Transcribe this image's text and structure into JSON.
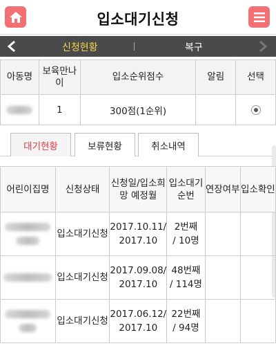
{
  "header": {
    "title": "입소대기신청",
    "home_icon": "home-icon",
    "menu_icon": "hamburger-menu-icon",
    "accent_color": "#f26f73"
  },
  "subnav": {
    "active_tab": "신청현황",
    "other_tab": "복구",
    "active_color": "#f4d44e"
  },
  "summary_table": {
    "headers": [
      "아동명",
      "보육만나이",
      "입소순위점수",
      "알림",
      "선택"
    ],
    "row": {
      "age": "1",
      "score": "300점(1순위)",
      "notice": "",
      "selected": true
    }
  },
  "tabs": {
    "waiting": "대기현황",
    "hold": "보류현황",
    "cancel": "취소내역"
  },
  "waiting_table": {
    "headers": [
      "어린이집명",
      "신청상태",
      "신청일/입소희망 예정월",
      "입소대기 순번",
      "연장여부",
      "입소확인"
    ],
    "rows": [
      {
        "status": "입소대기신청",
        "date1": "2017.10.11/",
        "date2": "2017.10",
        "rank1": "2번째",
        "rank2": "/ 10명",
        "extension": "",
        "confirm": ""
      },
      {
        "status": "입소대기신청",
        "date1": "2017.09.08/",
        "date2": "2017.10",
        "rank1": "48번째",
        "rank2": "/ 114명",
        "extension": "",
        "confirm": ""
      },
      {
        "status": "입소대기신청",
        "date1": "2017.06.12/",
        "date2": "2017.10",
        "rank1": "22번째",
        "rank2": "/ 94명",
        "extension": "",
        "confirm": ""
      }
    ]
  }
}
